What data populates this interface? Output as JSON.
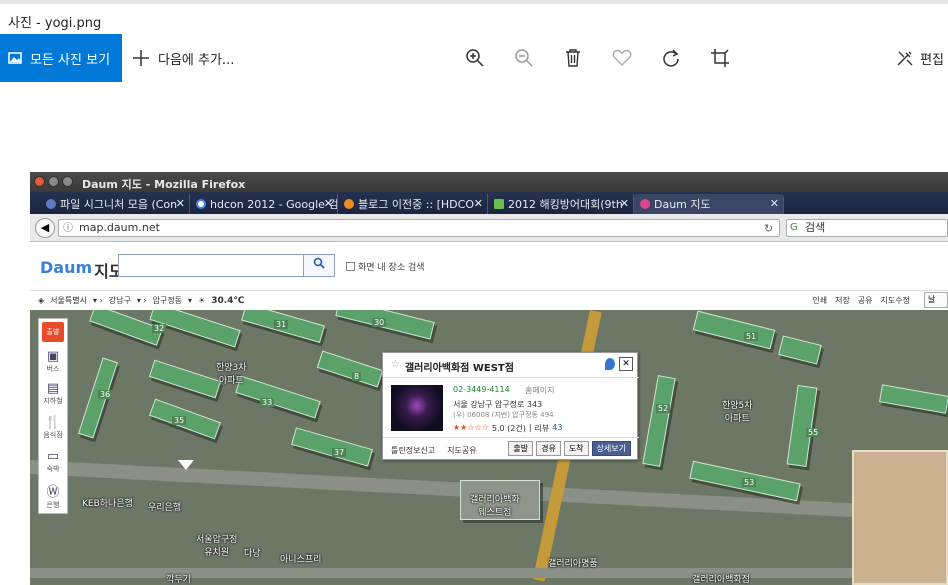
{
  "window": {
    "title": "사진 - yogi.png"
  },
  "toolbar": {
    "all_photos": "모든 사진 보기",
    "add_to": "다음에 추가...",
    "edit": "편집"
  },
  "firefox": {
    "title": "Daum 지도 - Mozilla Firefox",
    "tabs": [
      {
        "label": "파일 시그니처 모음 (Con",
        "color": "#5c7cc8"
      },
      {
        "label": "hdcon 2012 - Google 검",
        "color": "#ffffff"
      },
      {
        "label": "블로그 이전중 :: [HDCO",
        "color": "#f08a24"
      },
      {
        "label": "2012 해킹방어대회(9th",
        "color": "#6cbf4a"
      },
      {
        "label": "Daum 지도",
        "color": "#d94a8c"
      }
    ],
    "url": "map.daum.net",
    "search_placeholder": "검색"
  },
  "daum": {
    "logo_brand": "Daum",
    "logo_text": "지도",
    "checkbox_label": "화면 내 장소 검색",
    "crumbs": [
      "서울특별시",
      "강남구",
      "압구정동"
    ],
    "temperature": "30.4℃",
    "right_links": [
      "인쇄",
      "저장",
      "공유",
      "지도수정"
    ],
    "lang_btn": "날",
    "side_panel": [
      "출발",
      "버스",
      "지하철",
      "음식점",
      "숙박",
      "은행"
    ]
  },
  "popup": {
    "title": "갤러리아백화점 WEST점",
    "phone": "02-3449-4114",
    "homepage": "홈페이지",
    "address": "서울 강남구 압구정로 343",
    "zip": "(우) 06008 (지번) 압구정동 494",
    "rating": "5.0 (2건)",
    "review_label": "리뷰",
    "review_count": "43",
    "report": "틀린정보신고",
    "share": "지도공유",
    "btn_start": "출발",
    "btn_via": "경유",
    "btn_arrive": "도착",
    "btn_detail": "상세보기"
  },
  "map_labels": {
    "apt3": "한양3차\n아파트",
    "apt5": "한양5차\n아파트",
    "galleria": "갤러리아백화\n웨스트점",
    "keb": "KEB하나은행",
    "woori": "우리은행",
    "seoul_school": "서울압구정\n유치원",
    "aniseupeuri": "아니스프리",
    "galleria2": "갤러리아명품",
    "galleria3": "갤러리아백화점",
    "kkakdugi": "깍두기",
    "daenang": "다낭"
  },
  "building_numbers": [
    "32",
    "31",
    "30",
    "8",
    "33",
    "35",
    "36",
    "37",
    "51",
    "52",
    "53",
    "55"
  ]
}
